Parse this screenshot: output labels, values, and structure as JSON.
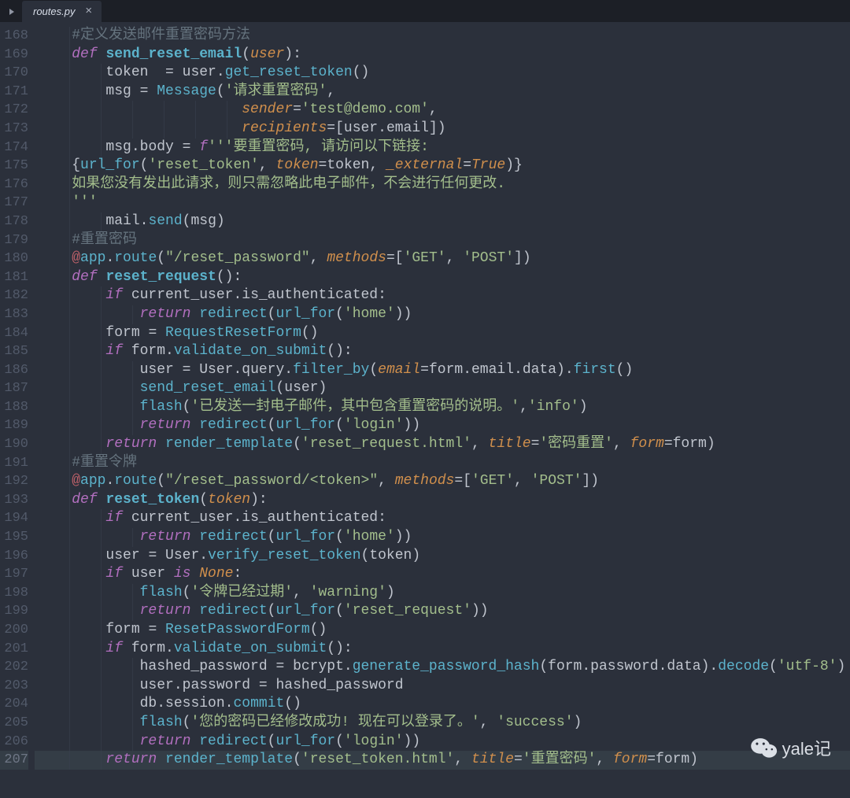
{
  "tab": {
    "filename": "routes.py",
    "close_tooltip": "Close"
  },
  "watermark": {
    "text": "yale记"
  },
  "line_start": 168,
  "line_end": 207,
  "active_line": 207,
  "indent_unit": 4,
  "code": [
    {
      "n": 168,
      "ind": 4,
      "t": [
        [
          "c-cmt",
          "#定义发送邮件重置密码方法"
        ]
      ]
    },
    {
      "n": 169,
      "ind": 4,
      "t": [
        [
          "c-kw",
          "def "
        ],
        [
          "c-def",
          "send_reset_email"
        ],
        [
          "c-punc",
          "("
        ],
        [
          "c-param",
          "user"
        ],
        [
          "c-punc",
          "):"
        ]
      ]
    },
    {
      "n": 170,
      "ind": 8,
      "t": [
        [
          "c-id",
          "token  "
        ],
        [
          "c-op",
          "= "
        ],
        [
          "c-id",
          "user"
        ],
        [
          "c-punc",
          "."
        ],
        [
          "c-call",
          "get_reset_token"
        ],
        [
          "c-punc",
          "()"
        ]
      ]
    },
    {
      "n": 171,
      "ind": 8,
      "t": [
        [
          "c-id",
          "msg "
        ],
        [
          "c-op",
          "= "
        ],
        [
          "c-call",
          "Message"
        ],
        [
          "c-punc",
          "("
        ],
        [
          "c-str",
          "'请求重置密码'"
        ],
        [
          "c-punc",
          ","
        ]
      ]
    },
    {
      "n": 172,
      "ind": 24,
      "t": [
        [
          "c-param",
          "sender"
        ],
        [
          "c-op",
          "="
        ],
        [
          "c-str",
          "'test@demo.com'"
        ],
        [
          "c-punc",
          ","
        ]
      ]
    },
    {
      "n": 173,
      "ind": 24,
      "t": [
        [
          "c-param",
          "recipients"
        ],
        [
          "c-op",
          "="
        ],
        [
          "c-punc",
          "["
        ],
        [
          "c-id",
          "user"
        ],
        [
          "c-punc",
          "."
        ],
        [
          "c-id",
          "email"
        ],
        [
          "c-punc",
          "])"
        ]
      ]
    },
    {
      "n": 174,
      "ind": 8,
      "t": [
        [
          "c-id",
          "msg"
        ],
        [
          "c-punc",
          "."
        ],
        [
          "c-id",
          "body "
        ],
        [
          "c-op",
          "= "
        ],
        [
          "c-fstr",
          "f"
        ],
        [
          "c-str",
          "'''要重置密码, 请访问以下链接:"
        ]
      ]
    },
    {
      "n": 175,
      "ind": 4,
      "t": [
        [
          "c-punc",
          "{"
        ],
        [
          "c-call",
          "url_for"
        ],
        [
          "c-punc",
          "("
        ],
        [
          "c-str",
          "'reset_token'"
        ],
        [
          "c-punc",
          ", "
        ],
        [
          "c-param",
          "token"
        ],
        [
          "c-op",
          "="
        ],
        [
          "c-id",
          "token"
        ],
        [
          "c-punc",
          ", "
        ],
        [
          "c-param",
          "_external"
        ],
        [
          "c-op",
          "="
        ],
        [
          "c-const",
          "True"
        ],
        [
          "c-punc",
          ")}"
        ]
      ]
    },
    {
      "n": 176,
      "ind": 4,
      "t": [
        [
          "c-strkw",
          "如果您没有发出此请求，则只需忽略此电子邮件，不会进行任何更改."
        ]
      ]
    },
    {
      "n": 177,
      "ind": 4,
      "t": [
        [
          "c-str",
          "'''"
        ]
      ]
    },
    {
      "n": 178,
      "ind": 8,
      "t": [
        [
          "c-id",
          "mail"
        ],
        [
          "c-punc",
          "."
        ],
        [
          "c-call",
          "send"
        ],
        [
          "c-punc",
          "("
        ],
        [
          "c-id",
          "msg"
        ],
        [
          "c-punc",
          ")"
        ]
      ]
    },
    {
      "n": 179,
      "ind": 4,
      "t": [
        [
          "c-cmt",
          "#重置密码"
        ]
      ]
    },
    {
      "n": 180,
      "ind": 4,
      "t": [
        [
          "c-at",
          "@"
        ],
        [
          "c-dec",
          "app"
        ],
        [
          "c-punc",
          "."
        ],
        [
          "c-dec",
          "route"
        ],
        [
          "c-punc",
          "("
        ],
        [
          "c-str",
          "\"/reset_password\""
        ],
        [
          "c-punc",
          ", "
        ],
        [
          "c-param",
          "methods"
        ],
        [
          "c-op",
          "="
        ],
        [
          "c-punc",
          "["
        ],
        [
          "c-str",
          "'GET'"
        ],
        [
          "c-punc",
          ", "
        ],
        [
          "c-str",
          "'POST'"
        ],
        [
          "c-punc",
          "])"
        ]
      ]
    },
    {
      "n": 181,
      "ind": 4,
      "t": [
        [
          "c-kw",
          "def "
        ],
        [
          "c-def",
          "reset_request"
        ],
        [
          "c-punc",
          "():"
        ]
      ]
    },
    {
      "n": 182,
      "ind": 8,
      "t": [
        [
          "c-kw",
          "if "
        ],
        [
          "c-id",
          "current_user"
        ],
        [
          "c-punc",
          "."
        ],
        [
          "c-id",
          "is_authenticated"
        ],
        [
          "c-punc",
          ":"
        ]
      ]
    },
    {
      "n": 183,
      "ind": 12,
      "t": [
        [
          "c-kw",
          "return "
        ],
        [
          "c-call",
          "redirect"
        ],
        [
          "c-punc",
          "("
        ],
        [
          "c-call",
          "url_for"
        ],
        [
          "c-punc",
          "("
        ],
        [
          "c-str",
          "'home'"
        ],
        [
          "c-punc",
          "))"
        ]
      ]
    },
    {
      "n": 184,
      "ind": 8,
      "t": [
        [
          "c-id",
          "form "
        ],
        [
          "c-op",
          "= "
        ],
        [
          "c-call",
          "RequestResetForm"
        ],
        [
          "c-punc",
          "()"
        ]
      ]
    },
    {
      "n": 185,
      "ind": 8,
      "t": [
        [
          "c-kw",
          "if "
        ],
        [
          "c-id",
          "form"
        ],
        [
          "c-punc",
          "."
        ],
        [
          "c-call",
          "validate_on_submit"
        ],
        [
          "c-punc",
          "():"
        ]
      ]
    },
    {
      "n": 186,
      "ind": 12,
      "t": [
        [
          "c-id",
          "user "
        ],
        [
          "c-op",
          "= "
        ],
        [
          "c-id",
          "User"
        ],
        [
          "c-punc",
          "."
        ],
        [
          "c-id",
          "query"
        ],
        [
          "c-punc",
          "."
        ],
        [
          "c-call",
          "filter_by"
        ],
        [
          "c-punc",
          "("
        ],
        [
          "c-param",
          "email"
        ],
        [
          "c-op",
          "="
        ],
        [
          "c-id",
          "form"
        ],
        [
          "c-punc",
          "."
        ],
        [
          "c-id",
          "email"
        ],
        [
          "c-punc",
          "."
        ],
        [
          "c-id",
          "data"
        ],
        [
          "c-punc",
          ")."
        ],
        [
          "c-call",
          "first"
        ],
        [
          "c-punc",
          "()"
        ]
      ]
    },
    {
      "n": 187,
      "ind": 12,
      "t": [
        [
          "c-call",
          "send_reset_email"
        ],
        [
          "c-punc",
          "("
        ],
        [
          "c-id",
          "user"
        ],
        [
          "c-punc",
          ")"
        ]
      ]
    },
    {
      "n": 188,
      "ind": 12,
      "t": [
        [
          "c-call",
          "flash"
        ],
        [
          "c-punc",
          "("
        ],
        [
          "c-str",
          "'已发送一封电子邮件，其中包含重置密码的说明。'"
        ],
        [
          "c-punc",
          ","
        ],
        [
          "c-str",
          "'info'"
        ],
        [
          "c-punc",
          ")"
        ]
      ]
    },
    {
      "n": 189,
      "ind": 12,
      "t": [
        [
          "c-kw",
          "return "
        ],
        [
          "c-call",
          "redirect"
        ],
        [
          "c-punc",
          "("
        ],
        [
          "c-call",
          "url_for"
        ],
        [
          "c-punc",
          "("
        ],
        [
          "c-str",
          "'login'"
        ],
        [
          "c-punc",
          "))"
        ]
      ]
    },
    {
      "n": 190,
      "ind": 8,
      "t": [
        [
          "c-kw",
          "return "
        ],
        [
          "c-call",
          "render_template"
        ],
        [
          "c-punc",
          "("
        ],
        [
          "c-str",
          "'reset_request.html'"
        ],
        [
          "c-punc",
          ", "
        ],
        [
          "c-param",
          "title"
        ],
        [
          "c-op",
          "="
        ],
        [
          "c-str",
          "'密码重置'"
        ],
        [
          "c-punc",
          ", "
        ],
        [
          "c-param",
          "form"
        ],
        [
          "c-op",
          "="
        ],
        [
          "c-id",
          "form"
        ],
        [
          "c-punc",
          ")"
        ]
      ]
    },
    {
      "n": 191,
      "ind": 4,
      "t": [
        [
          "c-cmt",
          "#重置令牌"
        ]
      ]
    },
    {
      "n": 192,
      "ind": 4,
      "t": [
        [
          "c-at",
          "@"
        ],
        [
          "c-dec",
          "app"
        ],
        [
          "c-punc",
          "."
        ],
        [
          "c-dec",
          "route"
        ],
        [
          "c-punc",
          "("
        ],
        [
          "c-str",
          "\"/reset_password/<token>\""
        ],
        [
          "c-punc",
          ", "
        ],
        [
          "c-param",
          "methods"
        ],
        [
          "c-op",
          "="
        ],
        [
          "c-punc",
          "["
        ],
        [
          "c-str",
          "'GET'"
        ],
        [
          "c-punc",
          ", "
        ],
        [
          "c-str",
          "'POST'"
        ],
        [
          "c-punc",
          "])"
        ]
      ]
    },
    {
      "n": 193,
      "ind": 4,
      "t": [
        [
          "c-kw",
          "def "
        ],
        [
          "c-def",
          "reset_token"
        ],
        [
          "c-punc",
          "("
        ],
        [
          "c-param",
          "token"
        ],
        [
          "c-punc",
          "):"
        ]
      ]
    },
    {
      "n": 194,
      "ind": 8,
      "t": [
        [
          "c-kw",
          "if "
        ],
        [
          "c-id",
          "current_user"
        ],
        [
          "c-punc",
          "."
        ],
        [
          "c-id",
          "is_authenticated"
        ],
        [
          "c-punc",
          ":"
        ]
      ]
    },
    {
      "n": 195,
      "ind": 12,
      "t": [
        [
          "c-kw",
          "return "
        ],
        [
          "c-call",
          "redirect"
        ],
        [
          "c-punc",
          "("
        ],
        [
          "c-call",
          "url_for"
        ],
        [
          "c-punc",
          "("
        ],
        [
          "c-str",
          "'home'"
        ],
        [
          "c-punc",
          "))"
        ]
      ]
    },
    {
      "n": 196,
      "ind": 8,
      "t": [
        [
          "c-id",
          "user "
        ],
        [
          "c-op",
          "= "
        ],
        [
          "c-id",
          "User"
        ],
        [
          "c-punc",
          "."
        ],
        [
          "c-call",
          "verify_reset_token"
        ],
        [
          "c-punc",
          "("
        ],
        [
          "c-id",
          "token"
        ],
        [
          "c-punc",
          ")"
        ]
      ]
    },
    {
      "n": 197,
      "ind": 8,
      "t": [
        [
          "c-kw",
          "if "
        ],
        [
          "c-id",
          "user "
        ],
        [
          "c-kw",
          "is "
        ],
        [
          "c-const",
          "None"
        ],
        [
          "c-punc",
          ":"
        ]
      ]
    },
    {
      "n": 198,
      "ind": 12,
      "t": [
        [
          "c-call",
          "flash"
        ],
        [
          "c-punc",
          "("
        ],
        [
          "c-str",
          "'令牌已经过期'"
        ],
        [
          "c-punc",
          ", "
        ],
        [
          "c-str",
          "'warning'"
        ],
        [
          "c-punc",
          ")"
        ]
      ]
    },
    {
      "n": 199,
      "ind": 12,
      "t": [
        [
          "c-kw",
          "return "
        ],
        [
          "c-call",
          "redirect"
        ],
        [
          "c-punc",
          "("
        ],
        [
          "c-call",
          "url_for"
        ],
        [
          "c-punc",
          "("
        ],
        [
          "c-str",
          "'reset_request'"
        ],
        [
          "c-punc",
          "))"
        ]
      ]
    },
    {
      "n": 200,
      "ind": 8,
      "t": [
        [
          "c-id",
          "form "
        ],
        [
          "c-op",
          "= "
        ],
        [
          "c-call",
          "ResetPasswordForm"
        ],
        [
          "c-punc",
          "()"
        ]
      ]
    },
    {
      "n": 201,
      "ind": 8,
      "t": [
        [
          "c-kw",
          "if "
        ],
        [
          "c-id",
          "form"
        ],
        [
          "c-punc",
          "."
        ],
        [
          "c-call",
          "validate_on_submit"
        ],
        [
          "c-punc",
          "():"
        ]
      ]
    },
    {
      "n": 202,
      "ind": 12,
      "t": [
        [
          "c-id",
          "hashed_password "
        ],
        [
          "c-op",
          "= "
        ],
        [
          "c-id",
          "bcrypt"
        ],
        [
          "c-punc",
          "."
        ],
        [
          "c-call",
          "generate_password_hash"
        ],
        [
          "c-punc",
          "("
        ],
        [
          "c-id",
          "form"
        ],
        [
          "c-punc",
          "."
        ],
        [
          "c-id",
          "password"
        ],
        [
          "c-punc",
          "."
        ],
        [
          "c-id",
          "data"
        ],
        [
          "c-punc",
          ")."
        ],
        [
          "c-call",
          "decode"
        ],
        [
          "c-punc",
          "("
        ],
        [
          "c-str",
          "'utf-8'"
        ],
        [
          "c-punc",
          ")"
        ]
      ]
    },
    {
      "n": 203,
      "ind": 12,
      "t": [
        [
          "c-id",
          "user"
        ],
        [
          "c-punc",
          "."
        ],
        [
          "c-id",
          "password "
        ],
        [
          "c-op",
          "= "
        ],
        [
          "c-id",
          "hashed_password"
        ]
      ]
    },
    {
      "n": 204,
      "ind": 12,
      "t": [
        [
          "c-id",
          "db"
        ],
        [
          "c-punc",
          "."
        ],
        [
          "c-id",
          "session"
        ],
        [
          "c-punc",
          "."
        ],
        [
          "c-call",
          "commit"
        ],
        [
          "c-punc",
          "()"
        ]
      ]
    },
    {
      "n": 205,
      "ind": 12,
      "t": [
        [
          "c-call",
          "flash"
        ],
        [
          "c-punc",
          "("
        ],
        [
          "c-str",
          "'您的密码已经修改成功! 现在可以登录了。'"
        ],
        [
          "c-punc",
          ", "
        ],
        [
          "c-str",
          "'success'"
        ],
        [
          "c-punc",
          ")"
        ]
      ]
    },
    {
      "n": 206,
      "ind": 12,
      "t": [
        [
          "c-kw",
          "return "
        ],
        [
          "c-call",
          "redirect"
        ],
        [
          "c-punc",
          "("
        ],
        [
          "c-call",
          "url_for"
        ],
        [
          "c-punc",
          "("
        ],
        [
          "c-str",
          "'login'"
        ],
        [
          "c-punc",
          "))"
        ]
      ]
    },
    {
      "n": 207,
      "ind": 8,
      "t": [
        [
          "c-kw",
          "return "
        ],
        [
          "c-call",
          "render_template"
        ],
        [
          "c-punc",
          "("
        ],
        [
          "c-str",
          "'reset_token.html'"
        ],
        [
          "c-punc",
          ", "
        ],
        [
          "c-param",
          "title"
        ],
        [
          "c-op",
          "="
        ],
        [
          "c-str",
          "'重置密码'"
        ],
        [
          "c-punc",
          ", "
        ],
        [
          "c-param",
          "form"
        ],
        [
          "c-op",
          "="
        ],
        [
          "c-id",
          "form"
        ],
        [
          "c-punc",
          ")"
        ]
      ]
    }
  ]
}
